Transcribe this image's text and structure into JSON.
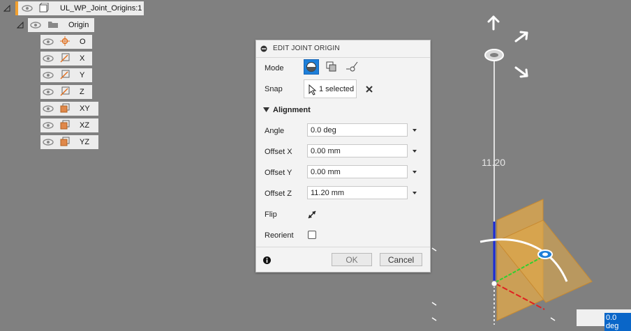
{
  "browser": {
    "root_label": "UL_WP_Joint_Origins:1",
    "origin_label": "Origin",
    "items": [
      {
        "label": "O",
        "icon": "point-icon"
      },
      {
        "label": "X",
        "icon": "axis-icon"
      },
      {
        "label": "Y",
        "icon": "axis-icon"
      },
      {
        "label": "Z",
        "icon": "axis-icon"
      },
      {
        "label": "XY",
        "icon": "plane-icon"
      },
      {
        "label": "XZ",
        "icon": "plane-icon"
      },
      {
        "label": "YZ",
        "icon": "plane-icon"
      }
    ]
  },
  "dialog": {
    "title": "EDIT JOINT ORIGIN",
    "mode_label": "Mode",
    "snap_label": "Snap",
    "snap_value": "1 selected",
    "alignment_header": "Alignment",
    "angle_label": "Angle",
    "angle_value": "0.0 deg",
    "offset_x_label": "Offset X",
    "offset_x_value": "0.00 mm",
    "offset_y_label": "Offset Y",
    "offset_y_value": "0.00 mm",
    "offset_z_label": "Offset Z",
    "offset_z_value": "11.20 mm",
    "flip_label": "Flip",
    "reorient_label": "Reorient",
    "ok_label": "OK",
    "cancel_label": "Cancel"
  },
  "viewport": {
    "dimension_label": "11.20",
    "angle_readout": "0.0 deg"
  },
  "colors": {
    "accent": "#1e7fd9",
    "plane": "#e0a84a",
    "x_axis": "#e02020",
    "y_axis": "#30d030",
    "z_axis": "#2030d0"
  }
}
